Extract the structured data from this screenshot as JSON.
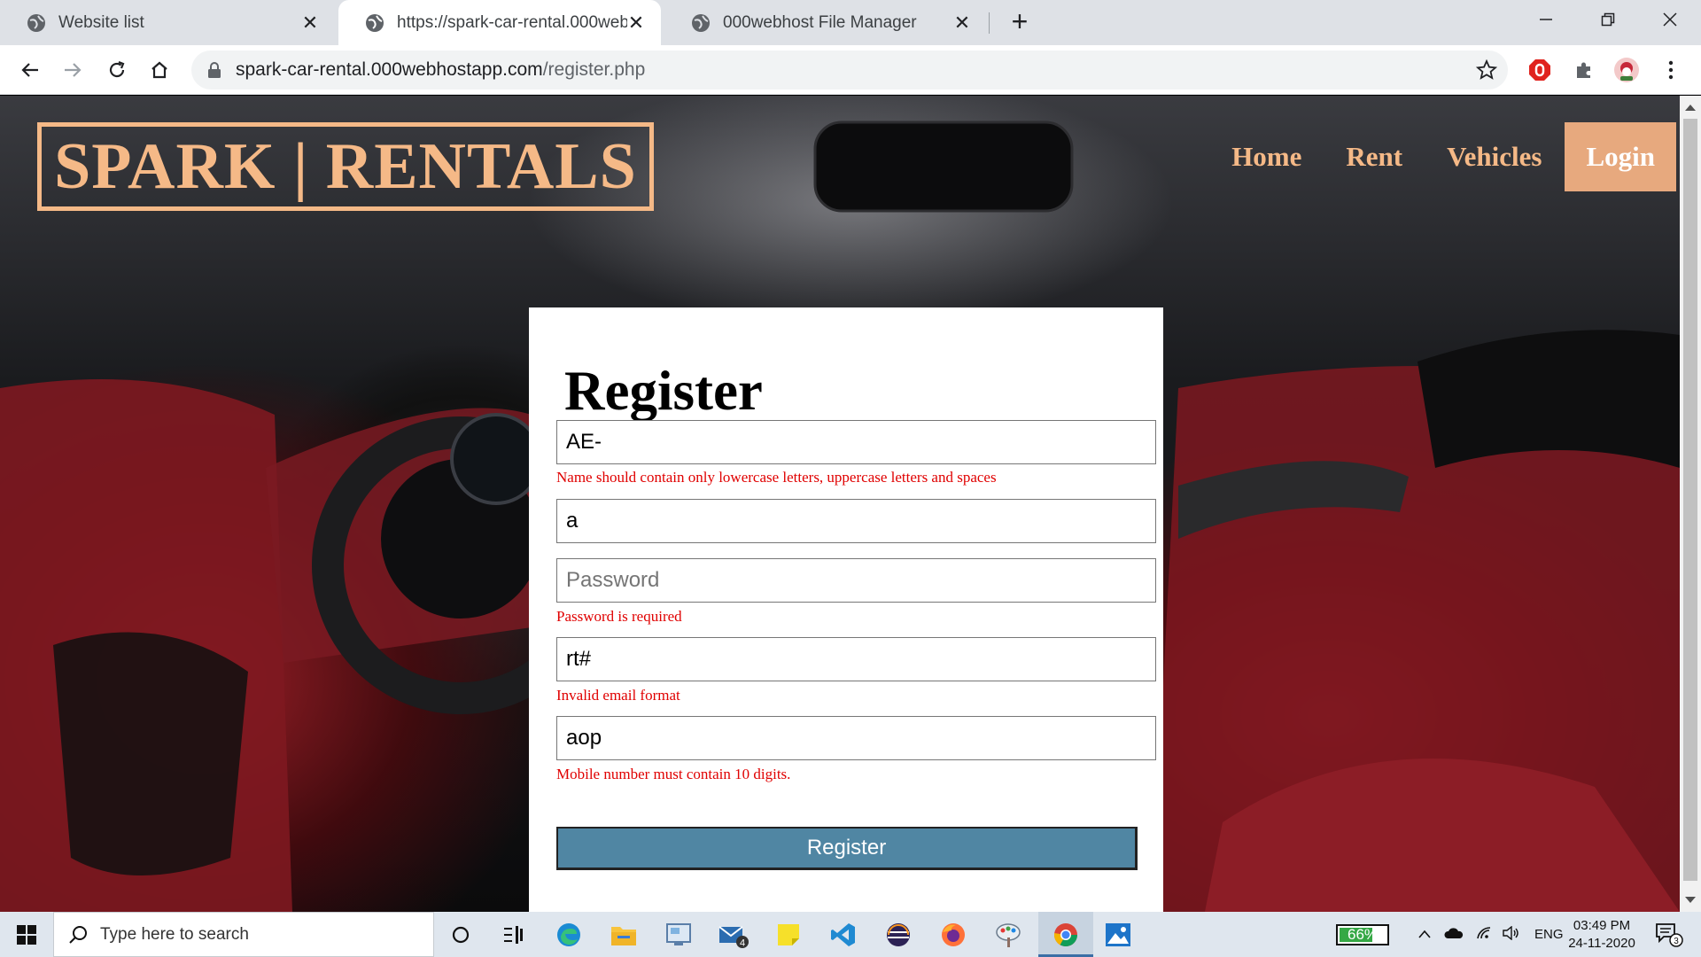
{
  "browser": {
    "tabs": [
      {
        "title": "Website list",
        "active": false
      },
      {
        "title": "https://spark-car-rental.000webhost",
        "active": true
      },
      {
        "title": "000webhost File Manager",
        "active": false
      }
    ],
    "url_host": "spark-car-rental.000webhostapp.com",
    "url_path": "/register.php"
  },
  "site": {
    "logo": "SPARK | RENTALS",
    "nav": {
      "home": "Home",
      "rent": "Rent",
      "vehicles": "Vehicles",
      "login": "Login"
    }
  },
  "form": {
    "title": "Register",
    "fields": {
      "name": {
        "value": "AE-",
        "error": "Name should contain only lowercase letters, uppercase letters and spaces"
      },
      "username": {
        "value": "a"
      },
      "password": {
        "value": "",
        "placeholder": "Password",
        "error": "Password is required"
      },
      "email": {
        "value": "rt#",
        "error": "Invalid email format"
      },
      "mobile": {
        "value": "aop",
        "error": "Mobile number must contain 10 digits."
      }
    },
    "submit_label": "Register"
  },
  "taskbar": {
    "search_placeholder": "Type here to search",
    "mail_badge": "4",
    "battery": "66%",
    "battery_level": 0.66,
    "language": "ENG",
    "time": "03:49 PM",
    "date": "24-11-2020",
    "notifications": "3"
  },
  "colors": {
    "accent_peach": "#f5b987",
    "login_bg": "#e7a97e",
    "submit_bg": "#5086a3",
    "error": "#e00000"
  }
}
